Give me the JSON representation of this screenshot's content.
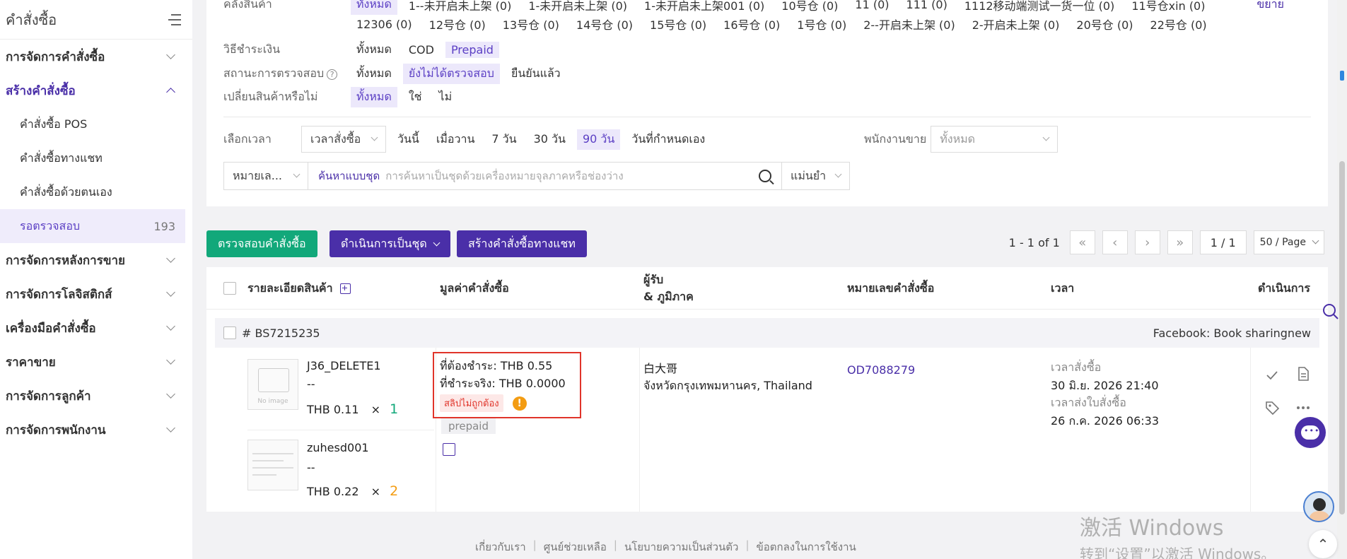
{
  "sidebar": {
    "title": "คำสั่งซื้อ",
    "sections": [
      {
        "label": "การจัดการคำสั่งซื้อ"
      },
      {
        "label": "สร้างคำสั่งซื้อ"
      }
    ],
    "sub_items": [
      {
        "label": "คำสั่งซื้อ POS"
      },
      {
        "label": "คำสั่งซื้อทางแชท"
      },
      {
        "label": "คำสั่งซื้อด้วยตนเอง"
      },
      {
        "label": "รอตรวจสอบ",
        "count": "193"
      }
    ],
    "sections_after": [
      {
        "label": "การจัดการหลังการขาย"
      },
      {
        "label": "การจัดการโลจิสติกส์"
      },
      {
        "label": "เครื่องมือคำสั่งซื้อ"
      },
      {
        "label": "ราคาขาย"
      },
      {
        "label": "การจัดการลูกค้า"
      },
      {
        "label": "การจัดการพนักงาน"
      }
    ]
  },
  "filters": {
    "warehouse_label": "คลังสินค้า",
    "warehouse_row1": [
      "ทั้งหมด",
      "1--未开启未上架 (0)",
      "1-未开启未上架 (0)",
      "1-未开启未上架001 (0)",
      "10号仓 (0)",
      "11 (0)",
      "111 (0)",
      "1112移动端测试一货一位 (0)",
      "11号仓xin (0)"
    ],
    "warehouse_row2": [
      "12306 (0)",
      "12号仓 (0)",
      "13号仓 (0)",
      "14号仓 (0)",
      "15号仓 (0)",
      "16号仓 (0)",
      "1号仓 (0)",
      "2--开启未上架 (0)",
      "2-开启未上架 (0)",
      "20号仓 (0)",
      "22号仓 (0)"
    ],
    "expand_label": "ขยาย",
    "payment_label": "วิธีชำระเงิน",
    "payment_options": [
      "ทั้งหมด",
      "COD",
      "Prepaid"
    ],
    "verify_label": "สถานะการตรวจสอบ",
    "verify_options": [
      "ทั้งหมด",
      "ยังไม่ได้ตรวจสอบ",
      "ยืนยันแล้ว"
    ],
    "exchange_label": "เปลี่ยนสินค้าหรือไม่",
    "exchange_options": [
      "ทั้งหมด",
      "ใช่",
      "ไม่"
    ],
    "time_label": "เลือกเวลา",
    "time_type": "เวลาสั่งซื้อ",
    "time_options": [
      "วันนี้",
      "เมื่อวาน",
      "7 วัน",
      "30 วัน",
      "90 วัน",
      "วันที่กำหนดเอง"
    ],
    "seller_label": "พนักงานขาย",
    "seller_value": "ทั้งหมด",
    "search_field": "หมายเล...",
    "batch_search": "ค้นหาแบบชุด",
    "search_placeholder": "การค้นหาเป็นชุดด้วยเครื่องหมายจุลภาคหรือช่องว่าง",
    "match_mode": "แม่นยำ"
  },
  "toolbar": {
    "verify_btn": "ตรวจสอบคำสั่งซื้อ",
    "batch_btn": "ดำเนินการเป็นชุด",
    "chat_order_btn": "สร้างคำสั่งซื้อทางแชท"
  },
  "pager": {
    "range": "1 - 1 of 1",
    "page": "1 / 1",
    "page_size": "50 / Page"
  },
  "table": {
    "headers": {
      "product": "รายละเอียดสินค้า",
      "value": "มูลค่าคำสั่งซื้อ",
      "recipient": "ผู้รับ",
      "region": "& ภูมิภาค",
      "order_no": "หมายเลขคำสั่งซื้อ",
      "time": "เวลา",
      "action": "ดำเนินการ"
    },
    "order": {
      "id": "# BS7215235",
      "platform": "Facebook: Book sharingnew",
      "products": [
        {
          "name": "J36_DELETE1",
          "sku": "--",
          "price": "THB 0.11",
          "times": "×",
          "qty": "1",
          "img_text": "No image"
        },
        {
          "name": "zuhesd001",
          "sku": "--",
          "price": "THB 0.22",
          "times": "×",
          "qty": "2"
        }
      ],
      "payable": "ที่ต้องชำระ: THB 0.55",
      "paid": "ที่ชำระจริง: THB 0.0000",
      "slip_tag": "สลิปไม่ถูกต้อง",
      "payment_tag": "prepaid",
      "recipient_name": "白大哥",
      "recipient_region": "จังหวัดกรุงเทพมหานคร, Thailand",
      "order_no": "OD7088279",
      "order_time_label": "เวลาสั่งซื้อ",
      "order_time": "30 มิ.ย. 2026 21:40",
      "submit_time_label": "เวลาส่งใบสั่งซื้อ",
      "submit_time": "26 ก.ค. 2026 06:33"
    }
  },
  "footer": {
    "links": [
      "เกี่ยวกับเรา",
      "ศูนย์ช่วยเหลือ",
      "นโยบายความเป็นส่วนตัว",
      "ข้อตกลงในการใช้งาน"
    ]
  },
  "watermark": {
    "line1": "激活 Windows",
    "line2": "转到“设置”以激活 Windows。"
  },
  "colors": {
    "brand_purple": "#4a2fa8",
    "green": "#12a87a",
    "error_red": "#e0342a",
    "warning_orange": "#f39c12"
  }
}
